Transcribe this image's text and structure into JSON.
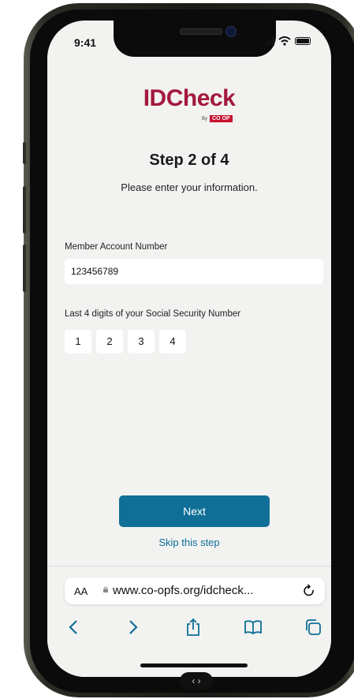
{
  "status_bar": {
    "time": "9:41"
  },
  "brand": {
    "logo_text": "IDCheck",
    "by_text": "By",
    "coop_text": "CO OP",
    "logo_color": "#a3193d"
  },
  "step": {
    "title": "Step 2 of 4",
    "subtitle": "Please enter your information."
  },
  "form": {
    "account_label": "Member Account Number",
    "account_value": "123456789",
    "ssn_label": "Last 4 digits of your Social Security Number",
    "ssn_digits": [
      "1",
      "2",
      "3",
      "4"
    ]
  },
  "actions": {
    "next_label": "Next",
    "skip_label": "Skip this step",
    "accent": "#0f6f97"
  },
  "browser": {
    "aa_label": "AA",
    "url": "www.co-opfs.org/idcheck...",
    "toolbar_icons": [
      "back-icon",
      "forward-icon",
      "share-icon",
      "bookmarks-icon",
      "tabs-icon"
    ]
  }
}
